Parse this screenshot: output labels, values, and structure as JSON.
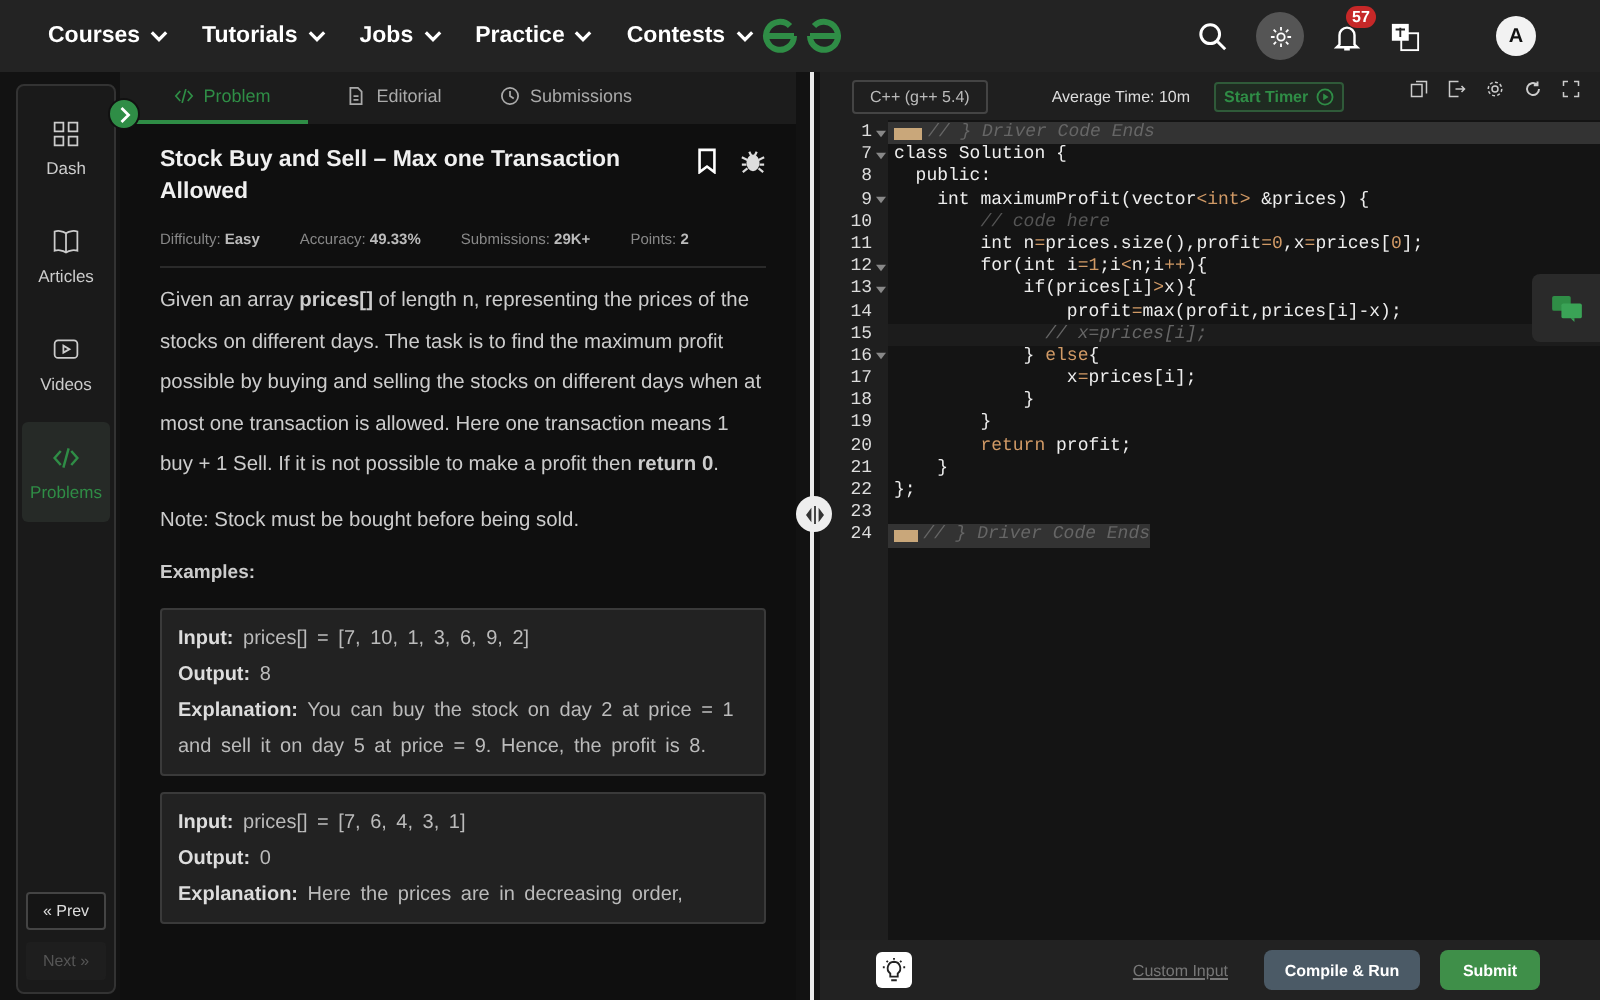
{
  "nav": {
    "menus": [
      {
        "label": "Courses"
      },
      {
        "label": "Tutorials"
      },
      {
        "label": "Jobs"
      },
      {
        "label": "Practice"
      },
      {
        "label": "Contests"
      }
    ],
    "notification_count": "57",
    "avatar_letter": "A"
  },
  "sidebar": {
    "items": [
      {
        "label": "Dash",
        "selected": false
      },
      {
        "label": "Articles",
        "selected": false
      },
      {
        "label": "Videos",
        "selected": false
      },
      {
        "label": "Problems",
        "selected": true
      }
    ],
    "prev": {
      "label": "« Prev",
      "disabled": false
    },
    "next": {
      "label": "Next »",
      "disabled": true
    }
  },
  "tabs": [
    {
      "label": "Problem",
      "selected": true
    },
    {
      "label": "Editorial",
      "selected": false
    },
    {
      "label": "Submissions",
      "selected": false
    }
  ],
  "problem": {
    "title": "Stock Buy and Sell – Max one Transaction Allowed",
    "meta": [
      {
        "label": "Difficulty:",
        "value": "Easy"
      },
      {
        "label": "Accuracy:",
        "value": "49.33%"
      },
      {
        "label": "Submissions:",
        "value": "29K+"
      },
      {
        "label": "Points:",
        "value": "2"
      }
    ],
    "description": "Given an array **prices[]** of length n, representing the prices of the stocks on different days. The task is to find the maximum profit possible by buying and selling the stocks on different days when at most one transaction is allowed. Here one transaction means 1 buy + 1 Sell. If it is not possible to make a profit then **return 0**.",
    "note": "Note: Stock must be bought before being sold.",
    "examples_heading": "Examples:",
    "examples": [
      [
        {
          "label": "Input:",
          "value": "prices[] = [7, 10, 1, 3, 6, 9, 2]"
        },
        {
          "label": "Output:",
          "value": "8"
        },
        {
          "label": "Explanation:",
          "value": "You can buy the stock on day 2 at price = 1 and sell it on day 5 at price = 9. Hence, the profit is 8."
        }
      ],
      [
        {
          "label": "Input:",
          "value": "prices[] = [7, 6, 4, 3, 1]"
        },
        {
          "label": "Output:",
          "value": "0"
        },
        {
          "label": "Explanation:",
          "value": "Here the prices are in decreasing order,"
        }
      ]
    ]
  },
  "editor": {
    "language": "C++ (g++ 5.4)",
    "average_time": "Average Time: 10m",
    "timer_button": "Start Timer",
    "lines": [
      {
        "number": "1",
        "foldable": true,
        "kind": "marker",
        "segments": [
          {
            "text": "// } Driver Code Ends",
            "kind": "comment"
          }
        ]
      },
      {
        "number": "7",
        "foldable": true,
        "segments": [
          {
            "text": "class Solution {",
            "kind": "plain"
          }
        ]
      },
      {
        "number": "8",
        "foldable": false,
        "segments": [
          {
            "text": "  public:",
            "kind": "plain"
          }
        ]
      },
      {
        "number": "9",
        "foldable": true,
        "segments": [
          {
            "text": "    int maximumProfit(vector",
            "kind": "plain"
          },
          {
            "text": "<int>",
            "kind": "accent"
          },
          {
            "text": " &prices) {",
            "kind": "plain"
          }
        ]
      },
      {
        "number": "10",
        "foldable": false,
        "segments": [
          {
            "text": "        // code here",
            "kind": "comment"
          }
        ]
      },
      {
        "number": "11",
        "foldable": false,
        "segments": [
          {
            "text": "        int n",
            "kind": "plain"
          },
          {
            "text": "=",
            "kind": "accent"
          },
          {
            "text": "prices.size(),profit",
            "kind": "plain"
          },
          {
            "text": "=0",
            "kind": "accent"
          },
          {
            "text": ",x",
            "kind": "plain"
          },
          {
            "text": "=",
            "kind": "accent"
          },
          {
            "text": "prices[",
            "kind": "plain"
          },
          {
            "text": "0",
            "kind": "accent"
          },
          {
            "text": "];",
            "kind": "plain"
          }
        ]
      },
      {
        "number": "12",
        "foldable": true,
        "segments": [
          {
            "text": "        for(int i",
            "kind": "plain"
          },
          {
            "text": "=1",
            "kind": "accent"
          },
          {
            "text": ";i",
            "kind": "plain"
          },
          {
            "text": "<",
            "kind": "accent"
          },
          {
            "text": "n;i",
            "kind": "plain"
          },
          {
            "text": "++",
            "kind": "accent"
          },
          {
            "text": "){",
            "kind": "plain"
          }
        ]
      },
      {
        "number": "13",
        "foldable": true,
        "segments": [
          {
            "text": "            if(prices[i]",
            "kind": "plain"
          },
          {
            "text": ">",
            "kind": "accent"
          },
          {
            "text": "x){",
            "kind": "plain"
          }
        ]
      },
      {
        "number": "14",
        "foldable": false,
        "segments": [
          {
            "text": "                profit",
            "kind": "plain"
          },
          {
            "text": "=",
            "kind": "accent"
          },
          {
            "text": "max(profit,prices[i]-x);",
            "kind": "plain"
          }
        ]
      },
      {
        "number": "15",
        "foldable": false,
        "current": true,
        "segments": [
          {
            "text": "              // x=prices[i];",
            "kind": "comment"
          }
        ]
      },
      {
        "number": "16",
        "foldable": true,
        "segments": [
          {
            "text": "            } ",
            "kind": "plain"
          },
          {
            "text": "else",
            "kind": "accent"
          },
          {
            "text": "{",
            "kind": "plain"
          }
        ]
      },
      {
        "number": "17",
        "foldable": false,
        "segments": [
          {
            "text": "                x",
            "kind": "plain"
          },
          {
            "text": "=",
            "kind": "accent"
          },
          {
            "text": "prices[i];",
            "kind": "plain"
          }
        ]
      },
      {
        "number": "18",
        "foldable": false,
        "segments": [
          {
            "text": "            }",
            "kind": "plain"
          }
        ]
      },
      {
        "number": "19",
        "foldable": false,
        "segments": [
          {
            "text": "        }",
            "kind": "plain"
          }
        ]
      },
      {
        "number": "20",
        "foldable": false,
        "segments": [
          {
            "text": "        return",
            "kind": "accent"
          },
          {
            "text": " profit;",
            "kind": "plain"
          }
        ]
      },
      {
        "number": "21",
        "foldable": false,
        "segments": [
          {
            "text": "    }",
            "kind": "plain"
          }
        ]
      },
      {
        "number": "22",
        "foldable": false,
        "segments": [
          {
            "text": "};",
            "kind": "plain"
          }
        ]
      },
      {
        "number": "23",
        "foldable": false
      },
      {
        "number": "24",
        "foldable": false,
        "kind": "marker",
        "segments": [
          {
            "text": "// } Driver Code Ends",
            "kind": "comment"
          }
        ]
      }
    ],
    "custom_input": "Custom Input",
    "compile_button": "Compile & Run",
    "submit_button": "Submit"
  }
}
